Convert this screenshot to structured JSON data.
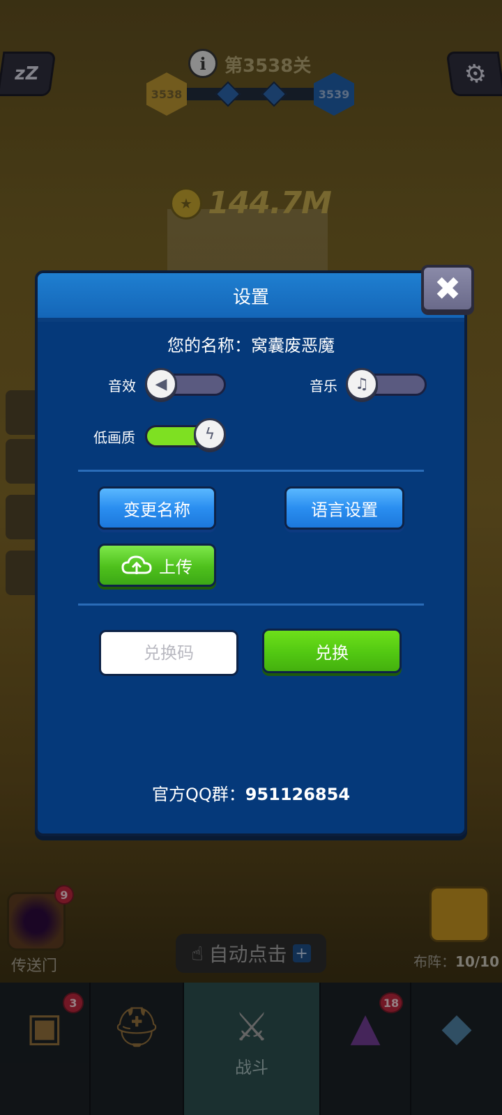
{
  "hud": {
    "sleep_icon": "zzz-icon",
    "settings_icon": "gear-icon",
    "info_icon": "info-icon",
    "level_title": "第3538关",
    "current_level": "3538",
    "next_level": "3539",
    "coins": "144.7M"
  },
  "dialog": {
    "title": "设置",
    "close_label": "✖",
    "player_name_line": "您的名称：窝囊废恶魔",
    "sound_effects_label": "音效",
    "music_label": "音乐",
    "low_quality_label": "低画质",
    "rename_button": "变更名称",
    "language_button": "语言设置",
    "upload_button": "上传",
    "redeem_placeholder": "兑换码",
    "redeem_button": "兑换",
    "qq_prefix": "官方QQ群：",
    "qq_number": "951126854"
  },
  "game_hud": {
    "portal_label": "传送门",
    "portal_badge": "9",
    "auto_click_label": "自动点击",
    "auto_click_plus": "+",
    "formation_prefix": "布阵：",
    "formation_value": "10/10"
  },
  "bottom_nav": {
    "chest_badge": "3",
    "battle_label": "战斗",
    "book_badge": "18"
  },
  "colors": {
    "dialog_bg": "#05397a",
    "dialog_header": "#1f7fd0",
    "toggle_on": "#7ee022",
    "toggle_off": "#5a5a80",
    "button_blue": "#2a8ef0",
    "button_green": "#4ec01c"
  }
}
